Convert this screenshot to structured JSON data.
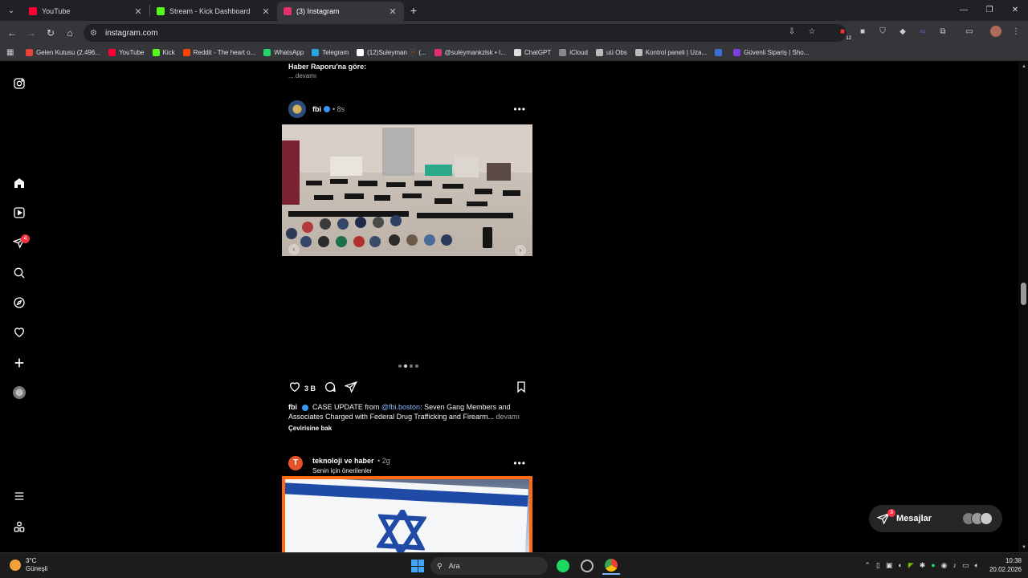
{
  "browser": {
    "tabs": [
      {
        "title": "YouTube",
        "color": "#ff0033",
        "active": false
      },
      {
        "title": "Stream - Kick Dashboard",
        "color": "#53fc18",
        "active": false
      },
      {
        "title": "(3) Instagram",
        "color": "#e1306c",
        "active": true
      }
    ],
    "url": "instagram.com",
    "bookmarks": [
      {
        "label": "Gelen Kutusu (2.496...",
        "color": "#ea4335"
      },
      {
        "label": "YouTube",
        "color": "#ff0033"
      },
      {
        "label": "Kick",
        "color": "#53fc18"
      },
      {
        "label": "Reddit - The heart o...",
        "color": "#ff4500"
      },
      {
        "label": "WhatsApp",
        "color": "#25d366"
      },
      {
        "label": "Telegram",
        "color": "#2aa3df"
      },
      {
        "label": "(12)Suleyman 🫥 (...",
        "color": "#ffffff"
      },
      {
        "label": "@suleymankzlsk • I...",
        "color": "#e1306c"
      },
      {
        "label": "ChatGPT",
        "color": "#dddddd"
      },
      {
        "label": "iCloud",
        "color": "#888888"
      },
      {
        "label": "uü Obs",
        "color": "#bbbbbb"
      },
      {
        "label": "Kontrol paneli | Uza...",
        "color": "#bbbbbb"
      },
      {
        "label": "",
        "color": "#3b6fd6"
      },
      {
        "label": "Güvenli Sipariş | Sho...",
        "color": "#7b3fe4"
      }
    ],
    "extension_badge": "12"
  },
  "feed": {
    "previous_caption": "Haber Raporu'na göre:",
    "previous_more": "... devamı",
    "post1": {
      "username": "fbi",
      "time": "8s",
      "likes": "3 B",
      "caption_user": "fbi",
      "caption_pre": "CASE UPDATE from ",
      "caption_mention": "@fbi.boston",
      "caption_post": ": Seven Gang Members and Associates Charged with Federal Drug Trafficking and Firearm...",
      "caption_more": "devamı",
      "translate": "Çevirisine bak"
    },
    "post2": {
      "username": "teknoloji ve haber",
      "time": "2g",
      "subtitle": "Senin için önerilenler",
      "avatar_letter": "T"
    }
  },
  "sidebar": {
    "notification_count": "4"
  },
  "messages": {
    "label": "Mesajlar",
    "badge": "3"
  },
  "taskbar": {
    "temperature": "3°C",
    "weather": "Güneşli",
    "search": "Ara",
    "time": "10:38",
    "date": "20.02.2026"
  }
}
